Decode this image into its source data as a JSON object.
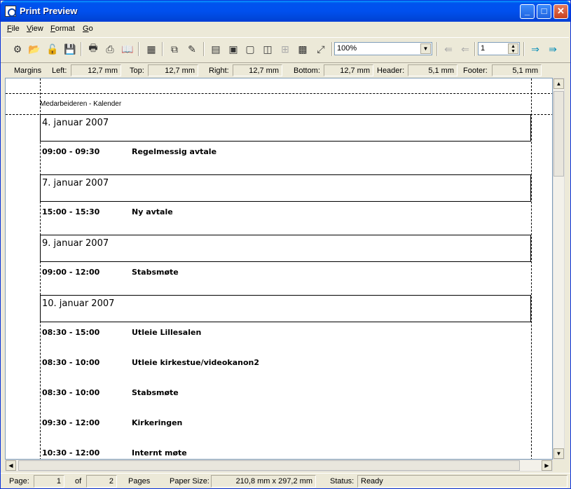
{
  "window": {
    "title": "Print Preview"
  },
  "menu": [
    {
      "label": "File",
      "ul": "F",
      "rest": "ile"
    },
    {
      "label": "View",
      "ul": "V",
      "rest": "iew"
    },
    {
      "label": "Format",
      "ul": "F",
      "rest": "ormat"
    },
    {
      "label": "Go",
      "ul": "G",
      "rest": "o"
    }
  ],
  "toolbar": {
    "zoom_value": "100%",
    "page_value": "1"
  },
  "margins": {
    "label": "Margins",
    "left_label": "Left:",
    "left": "12,7 mm",
    "top_label": "Top:",
    "top": "12,7 mm",
    "right_label": "Right:",
    "right": "12,7 mm",
    "bottom_label": "Bottom:",
    "bottom": "12,7 mm",
    "header_label": "Header:",
    "header": "5,1 mm",
    "footer_label": "Footer:",
    "footer": "5,1 mm"
  },
  "document": {
    "header": "Medarbeideren - Kalender",
    "days": [
      {
        "date": "4. januar 2007",
        "appointments": [
          {
            "time": "09:00 - 09:30",
            "title": "Regelmessig avtale"
          }
        ]
      },
      {
        "date": "7. januar 2007",
        "appointments": [
          {
            "time": "15:00 - 15:30",
            "title": "Ny avtale"
          }
        ]
      },
      {
        "date": "9. januar 2007",
        "appointments": [
          {
            "time": "09:00 - 12:00",
            "title": "Stabsmøte"
          }
        ]
      },
      {
        "date": "10. januar 2007",
        "appointments": [
          {
            "time": "08:30 - 15:00",
            "title": "Utleie Lillesalen"
          },
          {
            "time": "08:30 - 10:00",
            "title": "Utleie kirkestue/videokanon2"
          },
          {
            "time": "08:30 - 10:00",
            "title": "Stabsmøte"
          },
          {
            "time": "09:30 - 12:00",
            "title": "Kirkeringen"
          },
          {
            "time": "10:30 - 12:00",
            "title": "Internt møte"
          }
        ]
      }
    ]
  },
  "status": {
    "page_label": "Page:",
    "page": "1",
    "of_label": "of",
    "pages": "2",
    "pages_label": "Pages",
    "paper_label": "Paper Size:",
    "paper": "210,8 mm x 297,2 mm",
    "status_label": "Status:",
    "status": "Ready"
  }
}
